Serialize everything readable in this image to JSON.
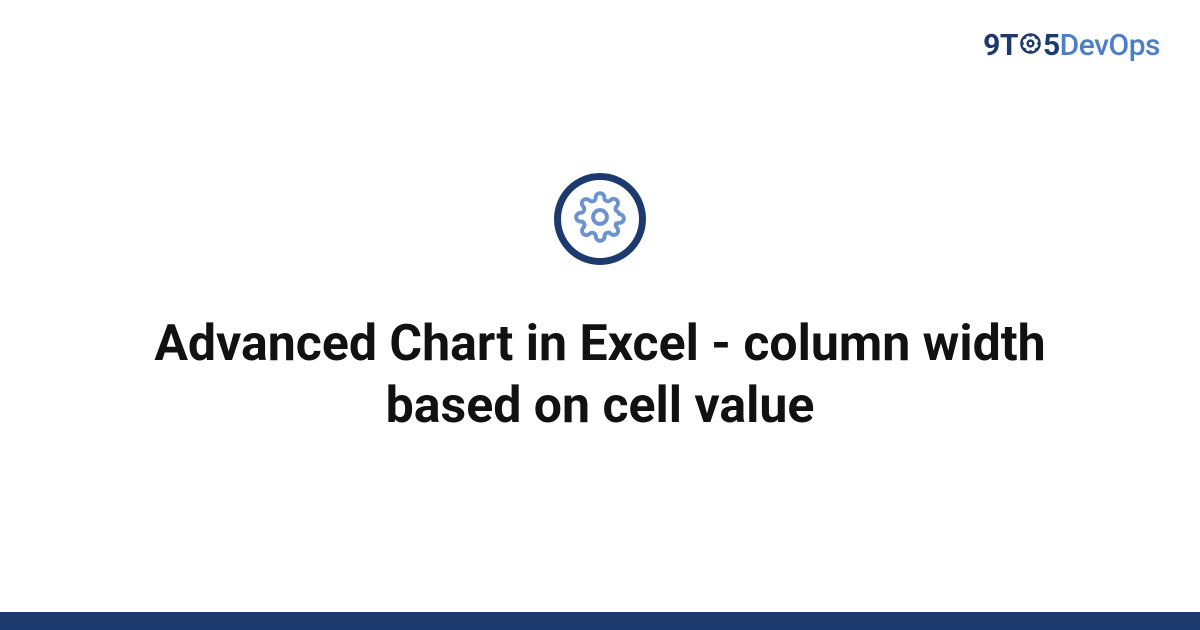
{
  "brand": {
    "prefix_nine": "9",
    "prefix_t": "T",
    "prefix_five": "5",
    "suffix": "DevOps",
    "colors": {
      "dark": "#1c3a6e",
      "light": "#4d7fc9"
    }
  },
  "headline": "Advanced Chart in Excel - column width based on cell value"
}
